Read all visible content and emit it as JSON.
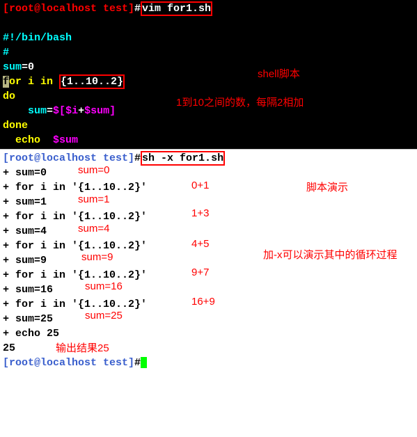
{
  "top": {
    "prompt_user_host": "[root@localhost test]",
    "hash": "#",
    "cmd1": "vim for1.sh",
    "shebang": "#!/bin/bash",
    "hash_line": "#",
    "sum_decl": "sum",
    "eq0": "=0",
    "for_f": "f",
    "for_rest": "or i in ",
    "brace_expr": "{1..10..2}",
    "do": "do",
    "sumassign_ws": "    ",
    "sum_var": "sum",
    "eq": "=",
    "expr": "$[",
    "i_var": "$i",
    "plus": "+",
    "sum_ref": "$sum",
    "cb": "]",
    "done": "done",
    "echo_kw": "  echo  ",
    "sum_out": "$sum",
    "ann_shell": "shell脚本",
    "ann_range": "1到10之间的数，每隔2相加"
  },
  "bottom": {
    "prompt": "[root@localhost test]",
    "hash": "#",
    "cmd2": "sh -x for1.sh",
    "trace": [
      "+ sum=0",
      "+ for i in '{1..10..2}'",
      "+ sum=1",
      "+ for i in '{1..10..2}'",
      "+ sum=4",
      "+ for i in '{1..10..2}'",
      "+ sum=9",
      "+ for i in '{1..10..2}'",
      "+ sum=16",
      "+ for i in '{1..10..2}'",
      "+ sum=25",
      "+ echo 25",
      "25"
    ],
    "prompt_end": "[root@localhost test]",
    "hash_end": "#",
    "ann_sum0": "sum=0",
    "ann_0p1": "0+1",
    "ann_sum1": "sum=1",
    "ann_1p3": "1+3",
    "ann_sum4": "sum=4",
    "ann_4p5": "4+5",
    "ann_sum9": "sum=9",
    "ann_9p7": "9+7",
    "ann_sum16": "sum=16",
    "ann_16p9": "16+9",
    "ann_sum25": "sum=25",
    "ann_result": "输出结果25",
    "ann_demo": "脚本演示",
    "ann_x": "加-x可以演示其中的循环过程"
  }
}
